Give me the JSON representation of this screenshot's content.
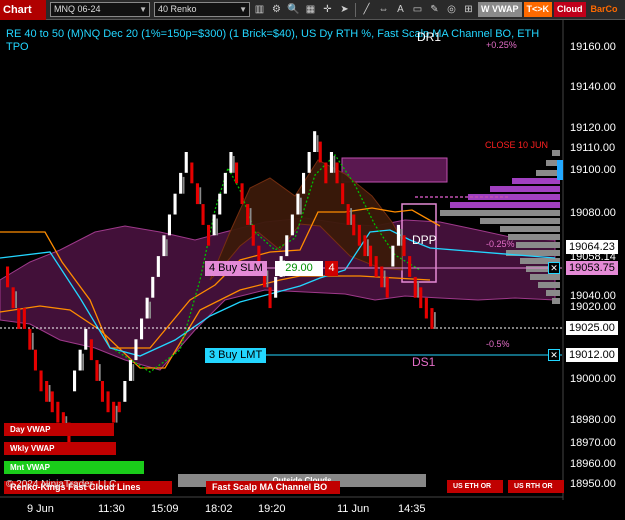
{
  "toolbar": {
    "title": "Chart",
    "instrument": "MNQ 06-24",
    "bar_type": "40 Renko",
    "buttons": [
      "W VWAP",
      "T<>K",
      "Cloud",
      "BarCo"
    ],
    "colors": {
      "title_bg": "#b00000",
      "wvwap_bg": "#8a8a8a",
      "tk_bg": "#ff6a00",
      "cloud_bg": "#c0001a",
      "barco_bg": "#2a2a2a"
    }
  },
  "header": {
    "line1": "RE 40 to 50 (M)NQ Dec 20 (1%=150p=$300) (1 Brick=$40), US Dy RTH %, Fast Scalp MA Channel BO, ETH",
    "line2": "TPO"
  },
  "annotations": {
    "dr1": "DR1",
    "pct_up": "+0.25%",
    "close10": "CLOSE 10 JUN",
    "dpp": "DPP",
    "pct_m025": "-0.25%",
    "pct_m05": "-0.5%",
    "ds1": "DS1"
  },
  "orders": {
    "buy_slm_label": "4 Buy SLM",
    "buy_slm_price": "29.00",
    "buy_slm_qty": "4",
    "buy_lmt_label": "3 Buy LMT",
    "close_x": "✕"
  },
  "price_axis": {
    "ticks": [
      "19160.00",
      "19140.00",
      "19120.00",
      "19110.00",
      "19100.00",
      "19080.00",
      "19058.14",
      "19040.00",
      "19020.00",
      "19000.00",
      "18980.00",
      "18970.00",
      "18960.00",
      "18950.00"
    ],
    "boxes": [
      {
        "value": "19064.23",
        "bg": "#ffffff",
        "fg": "#000000"
      },
      {
        "value": "19053.75",
        "bg": "#e48ad6",
        "fg": "#000000"
      },
      {
        "value": "19025.00",
        "bg": "#ffffff",
        "fg": "#000000"
      },
      {
        "value": "19012.00",
        "bg": "#ffffff",
        "fg": "#000000"
      }
    ]
  },
  "time_axis": [
    "9 Jun",
    "11:30",
    "15:09",
    "18:02",
    "19:20",
    "11 Jun",
    "14:35"
  ],
  "legend": {
    "day_vwap": "Day VWAP",
    "wkly_vwap": "Wkly VWAP",
    "mnt_vwap": "Mnt VWAP",
    "outside_clouds": "Outside Clouds",
    "fast_scalp": "Fast Scalp MA Channel BO",
    "us_eth_or": "US ETH OR",
    "us_rth_or": "US RTH OR",
    "copyright": "© 2024 NinjaTrader, LLC",
    "renko_lines": "Renko-Kings Fast Cloud Lines"
  },
  "chart_data": {
    "type": "bar",
    "title": "",
    "bar_type": "Renko",
    "brick_size": 10,
    "ylim": [
      18950,
      19165
    ],
    "bricks": [
      {
        "o": 19055,
        "c": 19045,
        "dir": "down"
      },
      {
        "o": 19045,
        "c": 19035,
        "dir": "down"
      },
      {
        "o": 19035,
        "c": 19025,
        "dir": "down"
      },
      {
        "o": 19035,
        "c": 19025,
        "dir": "down"
      },
      {
        "o": 19025,
        "c": 19015,
        "dir": "down"
      },
      {
        "o": 19015,
        "c": 19005,
        "dir": "down"
      },
      {
        "o": 19005,
        "c": 18995,
        "dir": "down"
      },
      {
        "o": 19000,
        "c": 18990,
        "dir": "down"
      },
      {
        "o": 18995,
        "c": 18985,
        "dir": "down"
      },
      {
        "o": 18990,
        "c": 18980,
        "dir": "down"
      },
      {
        "o": 18985,
        "c": 18975,
        "dir": "down"
      },
      {
        "o": 18980,
        "c": 18970,
        "dir": "down"
      },
      {
        "o": 18995,
        "c": 19005,
        "dir": "up"
      },
      {
        "o": 19005,
        "c": 19015,
        "dir": "up"
      },
      {
        "o": 19015,
        "c": 19025,
        "dir": "up"
      },
      {
        "o": 19020,
        "c": 19010,
        "dir": "down"
      },
      {
        "o": 19010,
        "c": 19000,
        "dir": "down"
      },
      {
        "o": 19000,
        "c": 18990,
        "dir": "down"
      },
      {
        "o": 18995,
        "c": 18985,
        "dir": "down"
      },
      {
        "o": 18990,
        "c": 18980,
        "dir": "down"
      },
      {
        "o": 18985,
        "c": 18990,
        "dir": "down"
      },
      {
        "o": 18990,
        "c": 19000,
        "dir": "up"
      },
      {
        "o": 19000,
        "c": 19010,
        "dir": "up"
      },
      {
        "o": 19010,
        "c": 19020,
        "dir": "up"
      },
      {
        "o": 19020,
        "c": 19030,
        "dir": "up"
      },
      {
        "o": 19030,
        "c": 19040,
        "dir": "up"
      },
      {
        "o": 19040,
        "c": 19050,
        "dir": "up"
      },
      {
        "o": 19050,
        "c": 19060,
        "dir": "up"
      },
      {
        "o": 19060,
        "c": 19070,
        "dir": "up"
      },
      {
        "o": 19070,
        "c": 19080,
        "dir": "up"
      },
      {
        "o": 19080,
        "c": 19090,
        "dir": "up"
      },
      {
        "o": 19090,
        "c": 19100,
        "dir": "up"
      },
      {
        "o": 19100,
        "c": 19110,
        "dir": "up"
      },
      {
        "o": 19105,
        "c": 19095,
        "dir": "down"
      },
      {
        "o": 19095,
        "c": 19085,
        "dir": "down"
      },
      {
        "o": 19085,
        "c": 19075,
        "dir": "down"
      },
      {
        "o": 19075,
        "c": 19065,
        "dir": "down"
      },
      {
        "o": 19070,
        "c": 19080,
        "dir": "up"
      },
      {
        "o": 19080,
        "c": 19090,
        "dir": "up"
      },
      {
        "o": 19090,
        "c": 19100,
        "dir": "up"
      },
      {
        "o": 19100,
        "c": 19110,
        "dir": "up"
      },
      {
        "o": 19105,
        "c": 19095,
        "dir": "down"
      },
      {
        "o": 19095,
        "c": 19085,
        "dir": "down"
      },
      {
        "o": 19085,
        "c": 19075,
        "dir": "down"
      },
      {
        "o": 19075,
        "c": 19065,
        "dir": "down"
      },
      {
        "o": 19065,
        "c": 19055,
        "dir": "down"
      },
      {
        "o": 19055,
        "c": 19045,
        "dir": "down"
      },
      {
        "o": 19045,
        "c": 19035,
        "dir": "down"
      },
      {
        "o": 19040,
        "c": 19050,
        "dir": "up"
      },
      {
        "o": 19050,
        "c": 19060,
        "dir": "up"
      },
      {
        "o": 19060,
        "c": 19070,
        "dir": "up"
      },
      {
        "o": 19070,
        "c": 19080,
        "dir": "up"
      },
      {
        "o": 19080,
        "c": 19090,
        "dir": "up"
      },
      {
        "o": 19090,
        "c": 19100,
        "dir": "up"
      },
      {
        "o": 19100,
        "c": 19110,
        "dir": "up"
      },
      {
        "o": 19110,
        "c": 19120,
        "dir": "up"
      },
      {
        "o": 19115,
        "c": 19105,
        "dir": "down"
      },
      {
        "o": 19105,
        "c": 19095,
        "dir": "down"
      },
      {
        "o": 19100,
        "c": 19110,
        "dir": "up"
      },
      {
        "o": 19105,
        "c": 19095,
        "dir": "down"
      },
      {
        "o": 19095,
        "c": 19085,
        "dir": "down"
      },
      {
        "o": 19085,
        "c": 19075,
        "dir": "down"
      },
      {
        "o": 19080,
        "c": 19070,
        "dir": "down"
      },
      {
        "o": 19075,
        "c": 19065,
        "dir": "down"
      },
      {
        "o": 19070,
        "c": 19060,
        "dir": "down"
      },
      {
        "o": 19065,
        "c": 19055,
        "dir": "down"
      },
      {
        "o": 19060,
        "c": 19050,
        "dir": "down"
      },
      {
        "o": 19055,
        "c": 19045,
        "dir": "down"
      },
      {
        "o": 19050,
        "c": 19040,
        "dir": "down"
      },
      {
        "o": 19055,
        "c": 19065,
        "dir": "up"
      },
      {
        "o": 19065,
        "c": 19075,
        "dir": "up"
      },
      {
        "o": 19070,
        "c": 19060,
        "dir": "down"
      },
      {
        "o": 19060,
        "c": 19050,
        "dir": "down"
      },
      {
        "o": 19050,
        "c": 19040,
        "dir": "down"
      },
      {
        "o": 19045,
        "c": 19035,
        "dir": "down"
      },
      {
        "o": 19040,
        "c": 19030,
        "dir": "down"
      },
      {
        "o": 19035,
        "c": 19025,
        "dir": "down"
      }
    ],
    "levels": {
      "last": 19025.0,
      "buy_slm": 19053.75,
      "buy_lmt": 19012.0,
      "level_64": 19064.23
    },
    "colors": {
      "up": "#ffffff",
      "down": "#e60000",
      "neutral": "#8a8a8a"
    }
  }
}
